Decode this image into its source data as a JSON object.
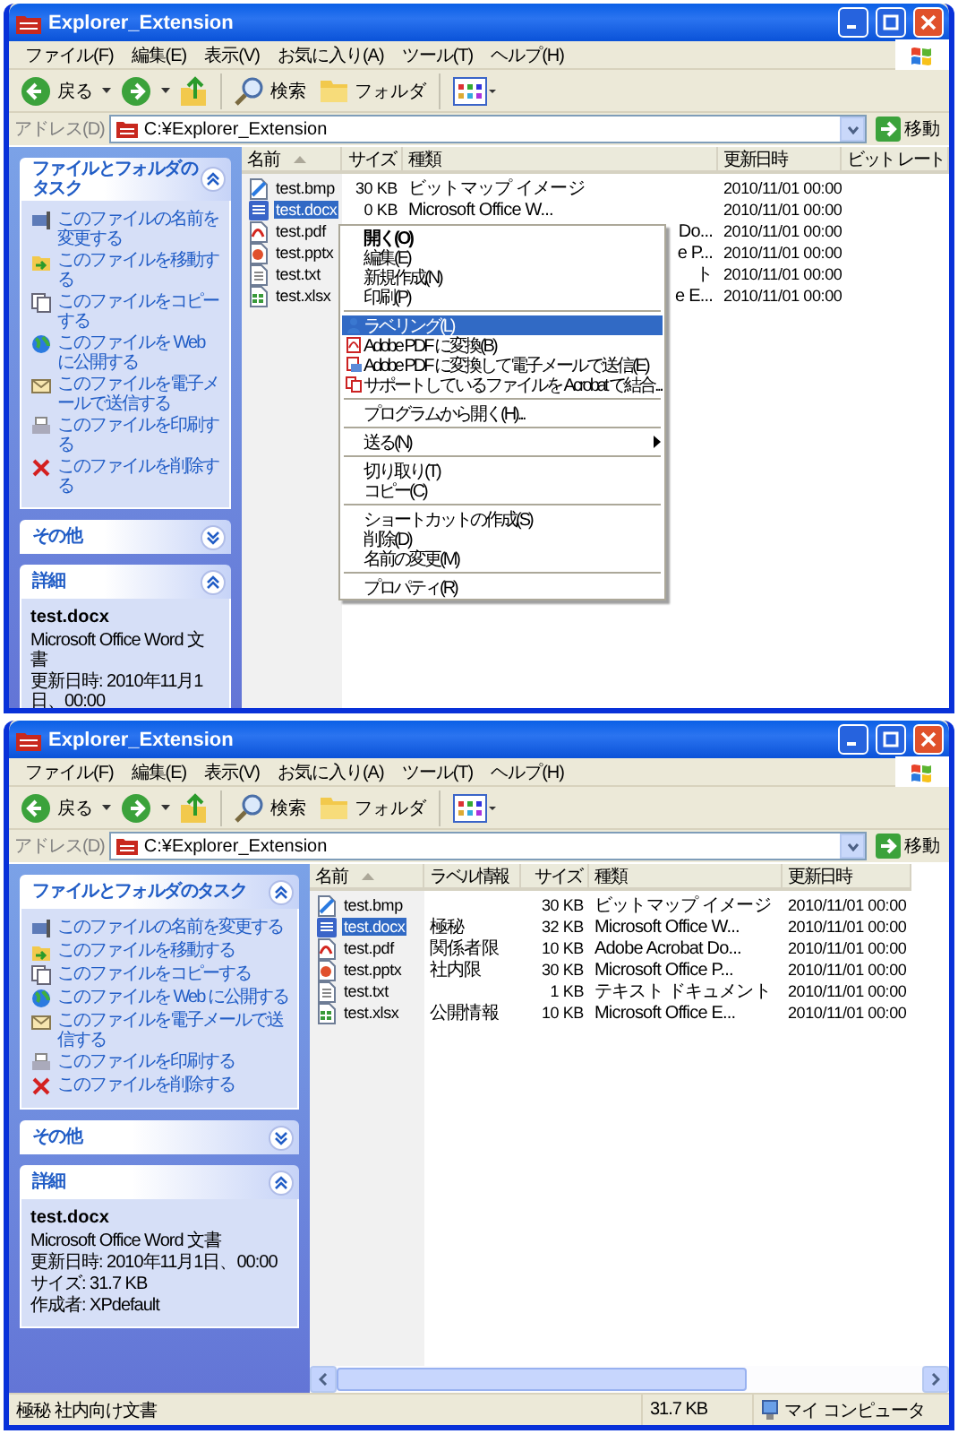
{
  "windows": [
    {
      "title": "Explorer_Extension",
      "menu": [
        "ファイル(F)",
        "編集(E)",
        "表示(V)",
        "お気に入り(A)",
        "ツール(T)",
        "ヘルプ(H)"
      ],
      "toolbar": {
        "back": "戻る",
        "search": "検索",
        "folders": "フォルダ"
      },
      "address": {
        "label": "アドレス(D)",
        "path": "C:¥Explorer_Extension",
        "go": "移動"
      },
      "tasks": {
        "title": "ファイルとフォルダのタスク",
        "expanded": true,
        "items": [
          {
            "kind": "rename",
            "text": "このファイルの名前を変更する"
          },
          {
            "kind": "move",
            "text": "このファイルを移動する"
          },
          {
            "kind": "copy",
            "text": "このファイルをコピーする"
          },
          {
            "kind": "publish",
            "text": "このファイルを Web に公開する"
          },
          {
            "kind": "email",
            "text": "このファイルを電子メールで送信する"
          },
          {
            "kind": "print",
            "text": "このファイルを印刷する"
          },
          {
            "kind": "delete",
            "text": "このファイルを削除する"
          }
        ]
      },
      "other": {
        "title": "その他",
        "expanded": false
      },
      "details": {
        "title": "詳細",
        "expanded": true,
        "name": "test.docx",
        "lines": [
          "Microsoft Office Word 文書",
          "更新日時: 2010年11月1日、00:00"
        ]
      },
      "columns": [
        {
          "kind": "name",
          "label": "名前",
          "sorted": true
        },
        {
          "kind": "size",
          "label": "サイズ",
          "sorted": false
        },
        {
          "kind": "type",
          "label": "種類",
          "sorted": false
        },
        {
          "kind": "date",
          "label": "更新日時",
          "sorted": false
        },
        {
          "kind": "other",
          "label": "ビット レート",
          "sorted": false
        }
      ],
      "rows": [
        {
          "kind": "bmp",
          "selected": false,
          "name": "test.bmp",
          "size": "30 KB",
          "type": "ビットマップ イメージ",
          "date": "2010/11/01 00:00"
        },
        {
          "kind": "docx",
          "selected": true,
          "name": "test.docx",
          "size": "0 KB",
          "type": "Microsoft Office W...",
          "date": "2010/11/01 00:00"
        },
        {
          "kind": "pdf",
          "selected": false,
          "name": "test.pdf",
          "type": "Do...",
          "date": "2010/11/01 00:00"
        },
        {
          "kind": "pptx",
          "selected": false,
          "name": "test.pptx",
          "type": "e P...",
          "date": "2010/11/01 00:00"
        },
        {
          "kind": "txt",
          "selected": false,
          "name": "test.txt",
          "type": "ト",
          "date": "2010/11/01 00:00"
        },
        {
          "kind": "xlsx",
          "selected": false,
          "name": "test.xlsx",
          "type": "e E...",
          "date": "2010/11/01 00:00"
        }
      ],
      "context_menu": [
        {
          "kind": "default",
          "text": "開く(O)",
          "selected": false
        },
        {
          "kind": "command",
          "text": "編集(E)",
          "selected": false
        },
        {
          "kind": "command",
          "text": "新規作成(N)",
          "selected": false
        },
        {
          "kind": "command",
          "text": "印刷(P)",
          "selected": false
        },
        {
          "kind": "separator"
        },
        {
          "kind": "label",
          "text": "ラベリング(L)",
          "selected": true
        },
        {
          "kind": "pdf",
          "text": "Adobe PDF に変換(B)",
          "selected": false
        },
        {
          "kind": "pdf-mail",
          "text": "Adobe PDF に変換して電子メールで送信(E)",
          "selected": false
        },
        {
          "kind": "combine",
          "text": "サポートしているファイルを Acrobat で結合...",
          "selected": false
        },
        {
          "kind": "separator"
        },
        {
          "kind": "command",
          "text": "プログラムから開く(H)...",
          "selected": false
        },
        {
          "kind": "separator"
        },
        {
          "kind": "submenu",
          "text": "送る(N)",
          "selected": false
        },
        {
          "kind": "separator"
        },
        {
          "kind": "command",
          "text": "切り取り(T)",
          "selected": false
        },
        {
          "kind": "command",
          "text": "コピー(C)",
          "selected": false
        },
        {
          "kind": "separator"
        },
        {
          "kind": "command",
          "text": "ショートカットの作成(S)",
          "selected": false
        },
        {
          "kind": "command",
          "text": "削除(D)",
          "selected": false
        },
        {
          "kind": "command",
          "text": "名前の変更(M)",
          "selected": false
        },
        {
          "kind": "separator"
        },
        {
          "kind": "command",
          "text": "プロパティ(R)",
          "selected": false
        }
      ]
    },
    {
      "title": "Explorer_Extension",
      "menu": [
        "ファイル(F)",
        "編集(E)",
        "表示(V)",
        "お気に入り(A)",
        "ツール(T)",
        "ヘルプ(H)"
      ],
      "toolbar": {
        "back": "戻る",
        "search": "検索",
        "folders": "フォルダ"
      },
      "address": {
        "label": "アドレス(D)",
        "path": "C:¥Explorer_Extension",
        "go": "移動"
      },
      "tasks": {
        "title": "ファイルとフォルダのタスク",
        "expanded": true,
        "items": [
          {
            "kind": "rename",
            "text": "このファイルの名前を変更する"
          },
          {
            "kind": "move",
            "text": "このファイルを移動する"
          },
          {
            "kind": "copy",
            "text": "このファイルをコピーする"
          },
          {
            "kind": "publish",
            "text": "このファイルを Web に公開する"
          },
          {
            "kind": "email",
            "text": "このファイルを電子メールで送信する"
          },
          {
            "kind": "print",
            "text": "このファイルを印刷する"
          },
          {
            "kind": "delete",
            "text": "このファイルを削除する"
          }
        ]
      },
      "other": {
        "title": "その他",
        "expanded": false
      },
      "details": {
        "title": "詳細",
        "expanded": true,
        "name": "test.docx",
        "lines": [
          "Microsoft Office Word 文書",
          "更新日時: 2010年11月1日、00:00",
          "サイズ: 31.7 KB",
          "作成者: XPdefault"
        ]
      },
      "columns": [
        {
          "kind": "name",
          "label": "名前",
          "sorted": true
        },
        {
          "kind": "label",
          "label": "ラベル情報",
          "sorted": false
        },
        {
          "kind": "size",
          "label": "サイズ",
          "sorted": false
        },
        {
          "kind": "type",
          "label": "種類",
          "sorted": false
        },
        {
          "kind": "date",
          "label": "更新日時",
          "sorted": false
        }
      ],
      "rows": [
        {
          "kind": "bmp",
          "selected": false,
          "name": "test.bmp",
          "size": "30 KB",
          "type": "ビットマップ イメージ",
          "date": "2010/11/01 00:00"
        },
        {
          "kind": "docx",
          "selected": true,
          "name": "test.docx",
          "label": "極秘",
          "size": "32 KB",
          "type": "Microsoft Office W...",
          "date": "2010/11/01 00:00"
        },
        {
          "kind": "pdf",
          "selected": false,
          "name": "test.pdf",
          "label": "関係者限",
          "size": "10 KB",
          "type": "Adobe Acrobat Do...",
          "date": "2010/11/01 00:00"
        },
        {
          "kind": "pptx",
          "selected": false,
          "name": "test.pptx",
          "label": "社内限",
          "size": "30 KB",
          "type": "Microsoft Office P...",
          "date": "2010/11/01 00:00"
        },
        {
          "kind": "txt",
          "selected": false,
          "name": "test.txt",
          "size": "1 KB",
          "type": "テキスト ドキュメント",
          "date": "2010/11/01 00:00"
        },
        {
          "kind": "xlsx",
          "selected": false,
          "name": "test.xlsx",
          "label": "公開情報",
          "size": "10 KB",
          "type": "Microsoft Office E...",
          "date": "2010/11/01 00:00"
        }
      ],
      "scrollbar": true,
      "status_bar": {
        "text": "極秘 社内向け文書",
        "size": "31.7 KB",
        "zone": "マイ コンピュータ"
      }
    }
  ]
}
